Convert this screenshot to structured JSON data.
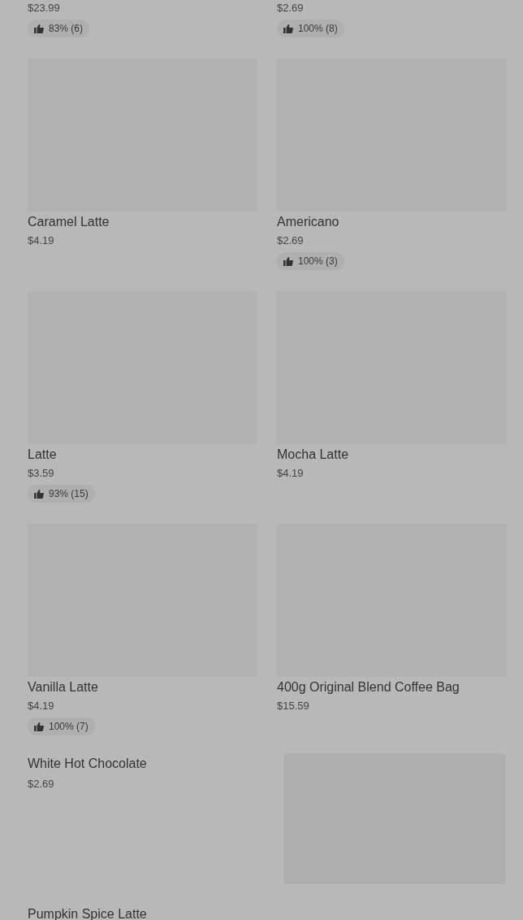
{
  "grid_items": [
    {
      "price": "$23.99",
      "rating": "83% (6)"
    },
    {
      "price": "$2.69",
      "rating": "100% (8)"
    },
    {
      "name": "Caramel Latte",
      "price": "$4.19",
      "image": {
        "kind": "placeholder"
      }
    },
    {
      "name": "Americano",
      "price": "$2.69",
      "rating": "100% (3)",
      "image": {
        "kind": "placeholder"
      }
    },
    {
      "name": "Latte",
      "price": "$3.59",
      "rating": "93% (15)",
      "image": {
        "kind": "placeholder"
      }
    },
    {
      "name": "Mocha Latte",
      "price": "$4.19",
      "image": {
        "kind": "placeholder"
      }
    },
    {
      "name": "Vanilla Latte",
      "price": "$4.19",
      "rating": "100% (7)",
      "image": {
        "kind": "placeholder"
      }
    },
    {
      "name": "400g Original Blend Coffee Bag",
      "price": "$15.59",
      "image": {
        "kind": "placeholder"
      }
    }
  ],
  "list_items": [
    {
      "name": "White Hot Chocolate",
      "price": "$2.69",
      "image": {
        "kind": "placeholder"
      }
    },
    {
      "name": "Pumpkin Spice Latte"
    }
  ]
}
